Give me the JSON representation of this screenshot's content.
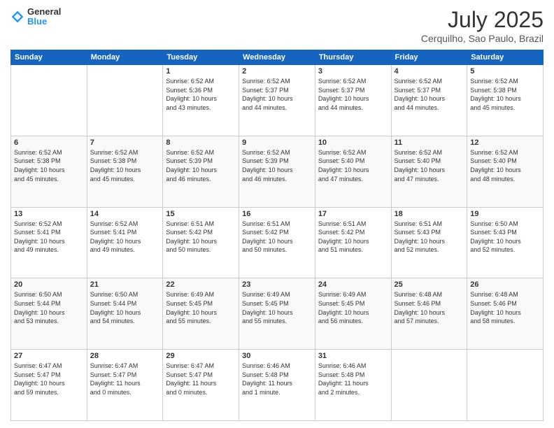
{
  "logo": {
    "line1": "General",
    "line2": "Blue"
  },
  "header": {
    "month": "July 2025",
    "location": "Cerquilho, Sao Paulo, Brazil"
  },
  "days_of_week": [
    "Sunday",
    "Monday",
    "Tuesday",
    "Wednesday",
    "Thursday",
    "Friday",
    "Saturday"
  ],
  "weeks": [
    [
      {
        "day": "",
        "info": ""
      },
      {
        "day": "",
        "info": ""
      },
      {
        "day": "1",
        "info": "Sunrise: 6:52 AM\nSunset: 5:36 PM\nDaylight: 10 hours\nand 43 minutes."
      },
      {
        "day": "2",
        "info": "Sunrise: 6:52 AM\nSunset: 5:37 PM\nDaylight: 10 hours\nand 44 minutes."
      },
      {
        "day": "3",
        "info": "Sunrise: 6:52 AM\nSunset: 5:37 PM\nDaylight: 10 hours\nand 44 minutes."
      },
      {
        "day": "4",
        "info": "Sunrise: 6:52 AM\nSunset: 5:37 PM\nDaylight: 10 hours\nand 44 minutes."
      },
      {
        "day": "5",
        "info": "Sunrise: 6:52 AM\nSunset: 5:38 PM\nDaylight: 10 hours\nand 45 minutes."
      }
    ],
    [
      {
        "day": "6",
        "info": "Sunrise: 6:52 AM\nSunset: 5:38 PM\nDaylight: 10 hours\nand 45 minutes."
      },
      {
        "day": "7",
        "info": "Sunrise: 6:52 AM\nSunset: 5:38 PM\nDaylight: 10 hours\nand 45 minutes."
      },
      {
        "day": "8",
        "info": "Sunrise: 6:52 AM\nSunset: 5:39 PM\nDaylight: 10 hours\nand 46 minutes."
      },
      {
        "day": "9",
        "info": "Sunrise: 6:52 AM\nSunset: 5:39 PM\nDaylight: 10 hours\nand 46 minutes."
      },
      {
        "day": "10",
        "info": "Sunrise: 6:52 AM\nSunset: 5:40 PM\nDaylight: 10 hours\nand 47 minutes."
      },
      {
        "day": "11",
        "info": "Sunrise: 6:52 AM\nSunset: 5:40 PM\nDaylight: 10 hours\nand 47 minutes."
      },
      {
        "day": "12",
        "info": "Sunrise: 6:52 AM\nSunset: 5:40 PM\nDaylight: 10 hours\nand 48 minutes."
      }
    ],
    [
      {
        "day": "13",
        "info": "Sunrise: 6:52 AM\nSunset: 5:41 PM\nDaylight: 10 hours\nand 49 minutes."
      },
      {
        "day": "14",
        "info": "Sunrise: 6:52 AM\nSunset: 5:41 PM\nDaylight: 10 hours\nand 49 minutes."
      },
      {
        "day": "15",
        "info": "Sunrise: 6:51 AM\nSunset: 5:42 PM\nDaylight: 10 hours\nand 50 minutes."
      },
      {
        "day": "16",
        "info": "Sunrise: 6:51 AM\nSunset: 5:42 PM\nDaylight: 10 hours\nand 50 minutes."
      },
      {
        "day": "17",
        "info": "Sunrise: 6:51 AM\nSunset: 5:42 PM\nDaylight: 10 hours\nand 51 minutes."
      },
      {
        "day": "18",
        "info": "Sunrise: 6:51 AM\nSunset: 5:43 PM\nDaylight: 10 hours\nand 52 minutes."
      },
      {
        "day": "19",
        "info": "Sunrise: 6:50 AM\nSunset: 5:43 PM\nDaylight: 10 hours\nand 52 minutes."
      }
    ],
    [
      {
        "day": "20",
        "info": "Sunrise: 6:50 AM\nSunset: 5:44 PM\nDaylight: 10 hours\nand 53 minutes."
      },
      {
        "day": "21",
        "info": "Sunrise: 6:50 AM\nSunset: 5:44 PM\nDaylight: 10 hours\nand 54 minutes."
      },
      {
        "day": "22",
        "info": "Sunrise: 6:49 AM\nSunset: 5:45 PM\nDaylight: 10 hours\nand 55 minutes."
      },
      {
        "day": "23",
        "info": "Sunrise: 6:49 AM\nSunset: 5:45 PM\nDaylight: 10 hours\nand 55 minutes."
      },
      {
        "day": "24",
        "info": "Sunrise: 6:49 AM\nSunset: 5:45 PM\nDaylight: 10 hours\nand 56 minutes."
      },
      {
        "day": "25",
        "info": "Sunrise: 6:48 AM\nSunset: 5:46 PM\nDaylight: 10 hours\nand 57 minutes."
      },
      {
        "day": "26",
        "info": "Sunrise: 6:48 AM\nSunset: 5:46 PM\nDaylight: 10 hours\nand 58 minutes."
      }
    ],
    [
      {
        "day": "27",
        "info": "Sunrise: 6:47 AM\nSunset: 5:47 PM\nDaylight: 10 hours\nand 59 minutes."
      },
      {
        "day": "28",
        "info": "Sunrise: 6:47 AM\nSunset: 5:47 PM\nDaylight: 11 hours\nand 0 minutes."
      },
      {
        "day": "29",
        "info": "Sunrise: 6:47 AM\nSunset: 5:47 PM\nDaylight: 11 hours\nand 0 minutes."
      },
      {
        "day": "30",
        "info": "Sunrise: 6:46 AM\nSunset: 5:48 PM\nDaylight: 11 hours\nand 1 minute."
      },
      {
        "day": "31",
        "info": "Sunrise: 6:46 AM\nSunset: 5:48 PM\nDaylight: 11 hours\nand 2 minutes."
      },
      {
        "day": "",
        "info": ""
      },
      {
        "day": "",
        "info": ""
      }
    ]
  ]
}
